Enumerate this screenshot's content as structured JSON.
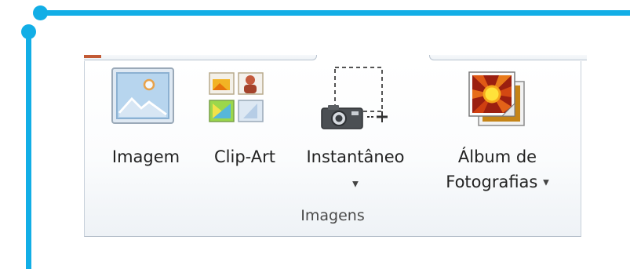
{
  "ribbon": {
    "group_label": "Imagens",
    "buttons": [
      {
        "label": "Imagem",
        "icon": "picture-icon"
      },
      {
        "label": "Clip-Art",
        "icon": "clip-art-icon"
      },
      {
        "label": "Instantâneo",
        "icon": "camera-screenshot-icon",
        "has_dropdown": true
      },
      {
        "label_line1": "Álbum de",
        "label_line2": "Fotografias",
        "icon": "photo-album-icon",
        "has_dropdown": true
      }
    ]
  },
  "colors": {
    "frame_accent": "#12aee6",
    "tab_accent": "#c25a35"
  }
}
